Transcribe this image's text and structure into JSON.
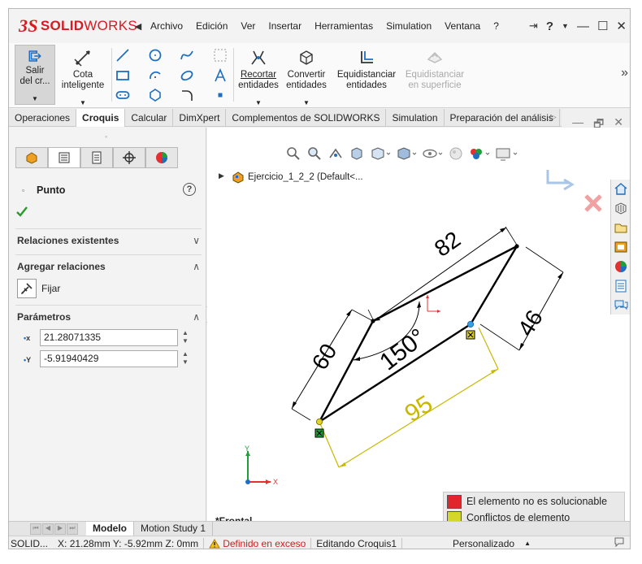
{
  "app": {
    "logo_ds": "3S",
    "logo_solid": "SOLID",
    "logo_works": "WORKS",
    "menu": [
      "Archivo",
      "Edición",
      "Ver",
      "Insertar",
      "Herramientas",
      "Simulation",
      "Ventana",
      "?"
    ],
    "window_buttons": {
      "help": "?",
      "minimize": "—",
      "maximize": "☐",
      "close": "✕"
    }
  },
  "ribbon": {
    "exit_sketch": {
      "line1": "Salir",
      "line2": "del cr..."
    },
    "smart_dimension": {
      "line1": "Cota",
      "line2": "inteligente"
    },
    "trim": {
      "line1": "Recortar",
      "line2": "entidades"
    },
    "convert": {
      "line1": "Convertir",
      "line2": "entidades"
    },
    "offset": {
      "line1": "Equidistanciar",
      "line2": "entidades"
    },
    "offset_surface": {
      "line1": "Equidistanciar",
      "line2": "en superficie"
    }
  },
  "tabs": [
    "Operaciones",
    "Croquis",
    "Calcular",
    "DimXpert",
    "Complementos de SOLIDWORKS",
    "Simulation",
    "Preparación del análisis"
  ],
  "active_tab": "Croquis",
  "panel": {
    "title": "Punto",
    "sections": {
      "existing": "Relaciones existentes",
      "add": "Agregar relaciones",
      "fix": "Fijar",
      "params": "Parámetros"
    },
    "params": {
      "x_label": "x",
      "y_label": "Y",
      "x_value": "21.28071335",
      "y_value": "-5.91940429"
    }
  },
  "viewport": {
    "tree_item": "Ejercicio_1_2_2  (Default<...",
    "view_name": "*Frontal",
    "dimensions": {
      "top": "82",
      "left": "60",
      "right": "46",
      "bottom": "95",
      "angle": "150°"
    },
    "legend": {
      "unsolvable": "El elemento no es solucionable",
      "conflict": "Conflictos de elemento"
    },
    "axis_y": "Y",
    "axis_x": "X"
  },
  "colors": {
    "unsolvable": "#e0262a",
    "conflict": "#d6d62a",
    "dim_conflict": "#c8b800",
    "geometry": "#000000",
    "accent": "#1e6fc2"
  },
  "bottom_tabs": [
    "Modelo",
    "Motion Study 1"
  ],
  "status": {
    "app": "SOLID...",
    "coords": "X: 21.28mm Y: -5.92mm Z: 0mm",
    "warning": "Definido en exceso",
    "editing": "Editando Croquis1",
    "units": "Personalizado"
  }
}
